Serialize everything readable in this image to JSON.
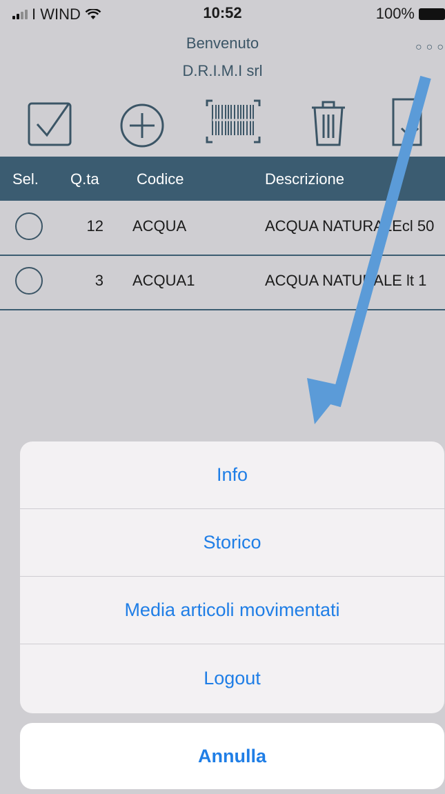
{
  "status_bar": {
    "carrier": "I WIND",
    "time": "10:52",
    "battery": "100%"
  },
  "header": {
    "greeting": "Benvenuto",
    "company": "D.R.I.M.I srl",
    "more_icon": "ellipsis-icon"
  },
  "toolbar": {
    "icons": [
      "checkbox-icon",
      "add-icon",
      "barcode-icon",
      "trash-icon",
      "export-document-icon"
    ]
  },
  "table": {
    "columns": [
      "Sel.",
      "Q.ta",
      "Codice",
      "Descrizione"
    ],
    "rows": [
      {
        "qty": "12",
        "code": "ACQUA",
        "description": "ACQUA NATURALEcl 50"
      },
      {
        "qty": "3",
        "code": "ACQUA1",
        "description": "ACQUA NATURALE lt 1"
      }
    ]
  },
  "action_sheet": {
    "items": [
      "Info",
      "Storico",
      "Media articoli movimentati",
      "Logout"
    ],
    "cancel": "Annulla"
  },
  "colors": {
    "header_bar": "#3b5c71",
    "accent": "#1f7ee6",
    "annotation_arrow": "#5b9bd8",
    "background": "#cfced2"
  }
}
